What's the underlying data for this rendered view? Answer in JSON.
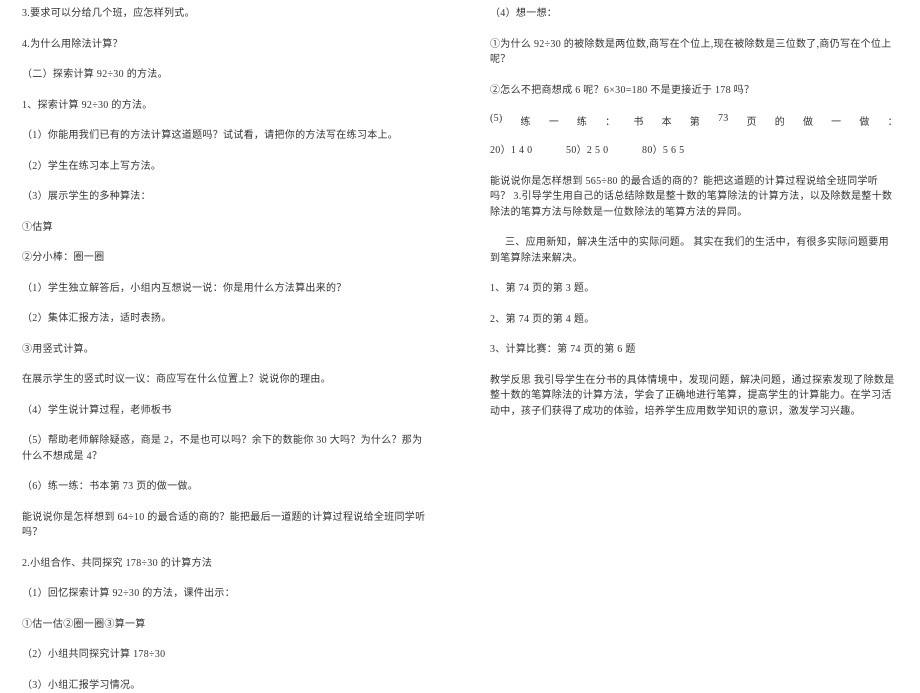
{
  "left": {
    "l1": "3.要求可以分给几个班，应怎样列式。",
    "l2": "4.为什么用除法计算？",
    "l3": "（二）探索计算 92÷30 的方法。",
    "l4": "1、探索计算 92÷30 的方法。",
    "l5": "（1）你能用我们已有的方法计算这道题吗？试试看，请把你的方法写在练习本上。",
    "l6": "（2）学生在练习本上写方法。",
    "l7": "（3）展示学生的多种算法：",
    "l8": "①估算",
    "l9": "②分小棒：圈一圈",
    "l10": "（1）学生独立解答后，小组内互想说一说：你是用什么方法算出来的？",
    "l11": "（2）集体汇报方法，适时表扬。",
    "l12": "③用竖式计算。",
    "l13": "在展示学生的竖式时议一议：商应写在什么位置上？说说你的理由。",
    "l14": "（4）学生说计算过程，老师板书",
    "l15": "（5）帮助老师解除疑惑，商是 2，不是也可以吗？余下的数能你 30 大吗？为什么？那为什么不想成是 4？",
    "l16": "（6）练一练：书本第 73 页的做一做。",
    "l17": "能说说你是怎样想到 64÷10 的最合适的商的？能把最后一道题的计算过程说给全班同学听吗？",
    "l18": "2.小组合作、共同探究 178÷30 的计算方法",
    "l19": "（1）回忆探索计算 92÷30 的方法，课件出示：",
    "l20": "①估一估②圈一圈③算一算",
    "l21": "（2）小组共同探究计算 178÷30",
    "l22": "（3）小组汇报学习情况。"
  },
  "right": {
    "r1": "（4）想一想：",
    "r2": "①为什么 92÷30 的被除数是两位数,商写在个位上,现在被除数是三位数了,商仍写在个位上呢？",
    "r3": "②怎么不把商想成 6 呢？6×30=180 不是更接近于 178 吗？",
    "row5a": "(5)",
    "row5_parts": [
      "练",
      "一",
      "练",
      "：",
      "书",
      "本",
      "第",
      "73",
      "页",
      "的",
      "做",
      "一",
      "做",
      "："
    ],
    "row6a": "20）1 4 0",
    "row6b": "50）2 5 0",
    "row6c": "80）5 6 5",
    "r7": "能说说你是怎样想到 565÷80 的最合适的商的？能把这道题的计算过程说给全班同学听吗？ 3.引导学生用自己的话总结除数是整十数的笔算除法的计算方法，以及除数是整十数除法的笔算方法与除数是一位数除法的笔算方法的异同。",
    "r8": "三、应用新知，解决生活中的实际问题。  其实在我们的生活中，有很多实际问题要用到笔算除法来解决。",
    "r9": "1、第 74 页的第 3 题。",
    "r10": "2、第 74 页的第 4 题。",
    "r11": "3、计算比赛：第 74 页的第 6 题",
    "r12": "教学反思  我引导学生在分书的具体情境中，发现问题，解决问题，通过探索发现了除数是整十数的笔算除法的计算方法，学会了正确地进行笔算，提高学生的计算能力。在学习活动中，孩子们获得了成功的体验，培养学生应用数学知识的意识，激发学习兴趣。"
  }
}
